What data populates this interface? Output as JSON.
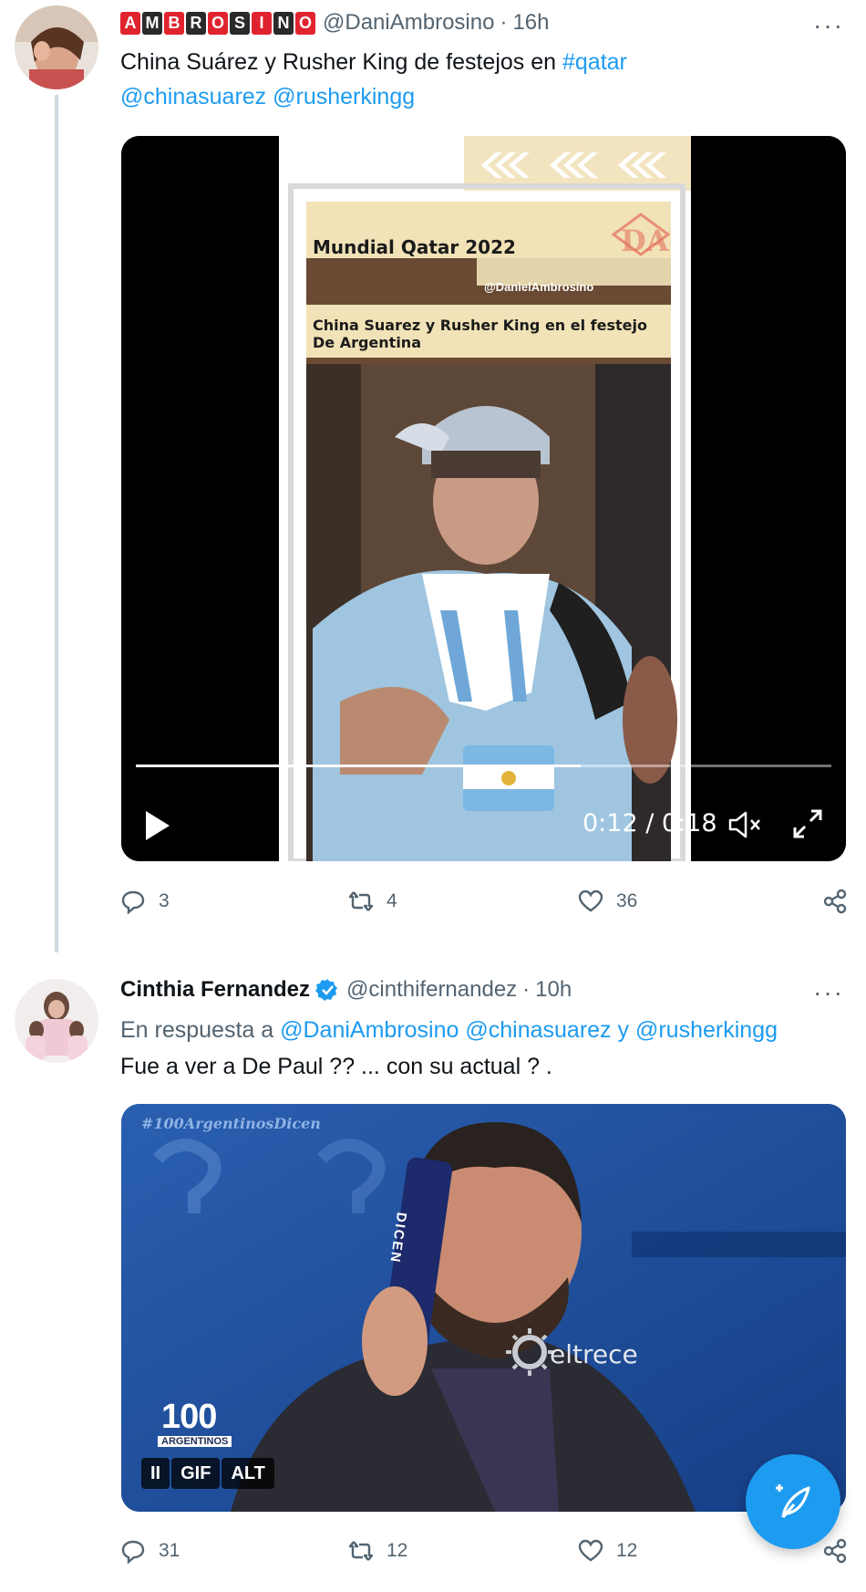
{
  "tweet1": {
    "brand_letters": [
      "A",
      "M",
      "B",
      "R",
      "O",
      "S",
      "I",
      "N",
      "O"
    ],
    "handle": "@DaniAmbrosino",
    "separator": "·",
    "time": "16h",
    "more": "···",
    "text": "China Suárez y Rusher King de festejos en ",
    "hashtag": "#qatar",
    "mention1": "@chinasuarez",
    "mention2": "@rusherkingg",
    "video": {
      "overlay_title": "Mundial Qatar 2022",
      "overlay_handle": "@DanielAmbrosino",
      "overlay_caption": "China Suarez y Rusher King en el festejo De Argentina",
      "logo_text": "DA",
      "time_display": "0:12 / 0:18",
      "progress": 0.64
    },
    "counts": {
      "replies": "3",
      "retweets": "4",
      "likes": "36"
    }
  },
  "tweet2": {
    "name": "Cinthia Fernandez",
    "handle": "@cinthifernandez",
    "separator": "·",
    "time": "10h",
    "more": "···",
    "reply_prefix": "En respuesta a ",
    "reply_to1": "@DaniAmbrosino",
    "reply_to2": "@chinasuarez",
    "reply_and": " y ",
    "reply_to3": "@rusherkingg",
    "text": "Fue a ver a De Paul ?? ... con su actual ? .",
    "gif": {
      "watermark": "#100ArgentinosDicen",
      "card_text": "DICEN",
      "logo_number": "100",
      "logo_sub": "ARGENTINOS",
      "channel": "eltrece",
      "pause": "II",
      "gif_label": "GIF",
      "alt_label": "ALT"
    },
    "counts": {
      "replies": "31",
      "retweets": "12",
      "likes": "12"
    }
  },
  "colors": {
    "accent": "#1d9bf0",
    "brand_red": "#e0242f",
    "brand_dark": "#2a2a2a",
    "muted": "#536471"
  }
}
